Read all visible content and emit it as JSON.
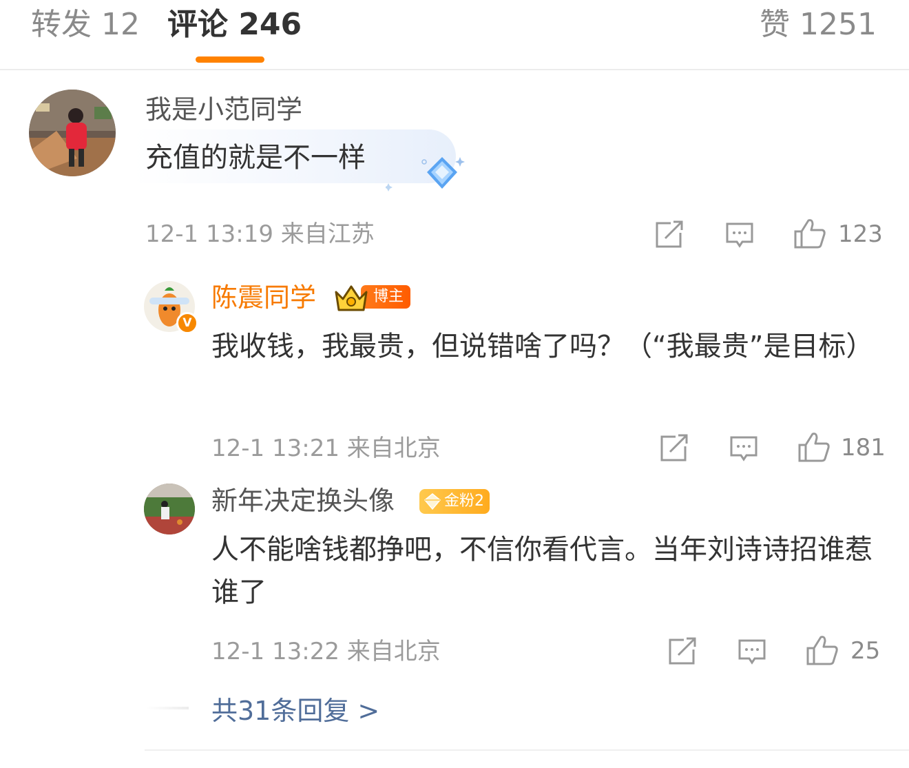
{
  "tabs": {
    "repost": "转发 12",
    "comment": "评论 246",
    "like": "赞 1251"
  },
  "colors": {
    "accent": "#ff8200",
    "username_orange": "#f77a00",
    "link_blue": "#506d99",
    "meta_gray": "#9b9b9b"
  },
  "comment": {
    "username": "我是小范同学",
    "text": "充值的就是不一样",
    "meta": "12-1 13:19  来自江苏",
    "like_count": "123"
  },
  "replies": [
    {
      "username": "陈震同学",
      "badge_label": "博主",
      "badge_icon": "crown-tv-icon",
      "verified": "V",
      "text": "我收钱，我最贵，但说错啥了吗？（“我最贵”是目标）",
      "meta": "12-1 13:21  来自北京",
      "like_count": "181"
    },
    {
      "username": "新年决定换头像",
      "badge_label": "金粉2",
      "badge_icon": "gold-gem-icon",
      "text": "人不能啥钱都挣吧，不信你看代言。当年刘诗诗招谁惹谁了",
      "meta": "12-1 13:22  来自北京",
      "like_count": "25"
    }
  ],
  "more_replies": "共31条回复 >"
}
